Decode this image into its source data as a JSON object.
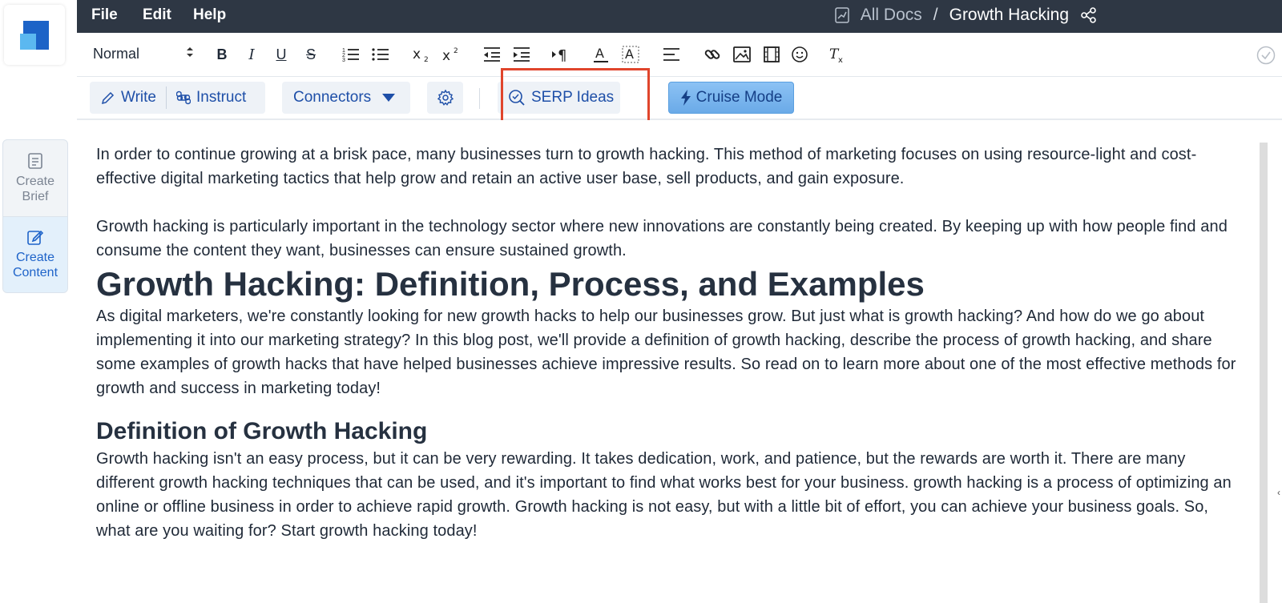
{
  "rail": {
    "items": [
      {
        "label_line1": "Create",
        "label_line2": "Brief"
      },
      {
        "label_line1": "Create",
        "label_line2": "Content"
      }
    ]
  },
  "menubar": {
    "items": [
      "File",
      "Edit",
      "Help"
    ],
    "breadcrumb": {
      "root": "All Docs",
      "separator": "/",
      "current": "Growth Hacking"
    }
  },
  "toolbar": {
    "style_select": "Normal",
    "icons": [
      "bold-icon",
      "italic-icon",
      "underline-icon",
      "strikethrough-icon",
      "ordered-list-icon",
      "bullet-list-icon",
      "subscript-icon",
      "superscript-icon",
      "outdent-icon",
      "indent-icon",
      "text-direction-icon",
      "font-color-icon",
      "highlight-color-icon",
      "align-icon",
      "link-icon",
      "image-icon",
      "video-icon",
      "emoji-icon",
      "clear-format-icon"
    ]
  },
  "actions": {
    "write": "Write",
    "instruct": "Instruct",
    "connectors": "Connectors",
    "serp": "SERP Ideas",
    "cruise": "Cruise Mode"
  },
  "colors": {
    "menubar": "#2e3744",
    "accent": "#1e4fa8",
    "highlight": "#e0452c"
  },
  "doc": {
    "p1": "In order to continue growing at a brisk pace, many businesses turn to growth hacking. This method of marketing focuses on using resource-light and cost-effective digital marketing tactics that help grow and retain an active user base, sell products, and gain exposure.",
    "p2": "Growth hacking is particularly important in the technology sector where new innovations are constantly being created. By keeping up with how people find and consume the content they want, businesses can ensure sustained growth.",
    "h1": "Growth Hacking: Definition, Process, and Examples",
    "p3": "As digital marketers, we're constantly looking for new growth hacks to help our businesses grow. But just what is growth hacking? And how do we go about implementing it into our marketing strategy? In this blog post, we'll provide a definition of growth hacking, describe the process of growth hacking, and share some examples of growth hacks that have helped businesses achieve impressive results. So read on to learn more about one of the most effective methods for growth and success in marketing today!",
    "h2": "Definition of Growth Hacking",
    "p4": "Growth hacking isn't an easy process, but it can be very rewarding. It takes dedication, work, and patience, but the rewards are worth it. There are many different growth hacking techniques that can be used, and it's important to find what works best for your business. growth hacking is a process of optimizing an online or offline business in order to achieve rapid growth. Growth hacking is not easy, but with a little bit of effort, you can achieve your business goals. So, what are you waiting for? Start growth hacking today!"
  }
}
